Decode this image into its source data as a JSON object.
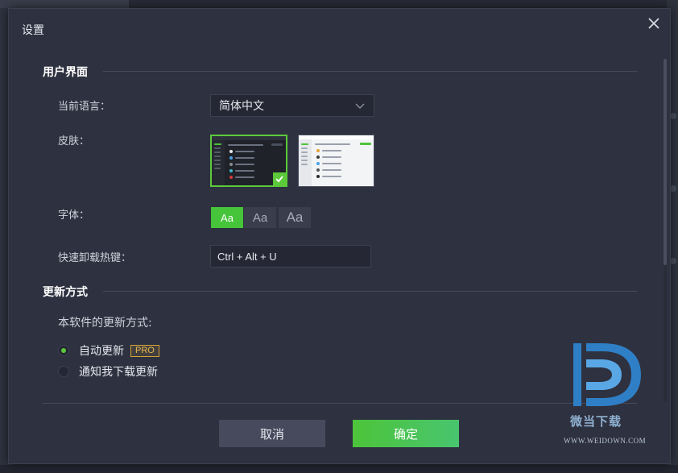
{
  "dialog": {
    "title": "设置",
    "close_icon": "close-icon"
  },
  "ui_section": {
    "heading": "用户界面",
    "language": {
      "label": "当前语言：",
      "selected": "简体中文"
    },
    "skin": {
      "label": "皮肤：",
      "selected": "dark"
    },
    "font": {
      "label": "字体：",
      "options": [
        "Aa",
        "Aa",
        "Aa"
      ],
      "selected_index": 0
    },
    "hotkey": {
      "label": "快速卸载热键：",
      "value": "Ctrl + Alt + U"
    }
  },
  "update_section": {
    "heading": "更新方式",
    "prompt": "本软件的更新方式:",
    "options": [
      {
        "label": "自动更新",
        "badge": "PRO",
        "selected": true
      },
      {
        "label": "通知我下载更新",
        "selected": false
      }
    ]
  },
  "footer": {
    "cancel_label": "取消",
    "ok_label": "确定"
  },
  "watermark": {
    "text": "微当下载",
    "url": "WWW.WEIDOWN.COM"
  },
  "colors": {
    "accent_green": "#4dc43a",
    "dialog_bg": "#2e313f",
    "badge_gold": "#d4a23a",
    "watermark_blue": "#2f7fc6"
  }
}
